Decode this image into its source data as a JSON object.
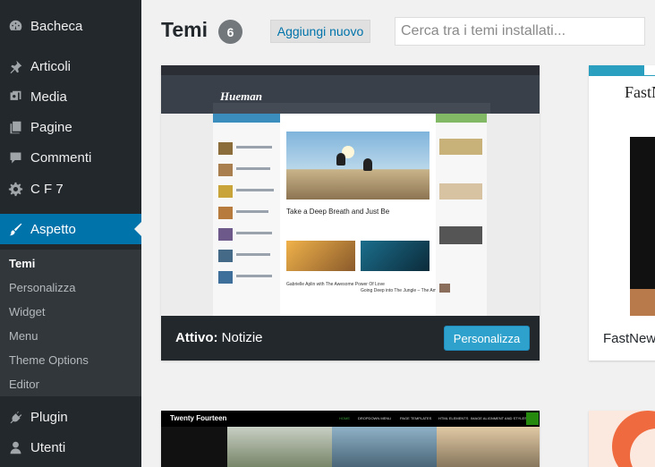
{
  "sidebar": {
    "items": [
      {
        "label": "Bacheca",
        "icon": "dashboard-icon"
      },
      {
        "label": "Articoli",
        "icon": "pin-icon"
      },
      {
        "label": "Media",
        "icon": "media-icon"
      },
      {
        "label": "Pagine",
        "icon": "pages-icon"
      },
      {
        "label": "Commenti",
        "icon": "comments-icon"
      },
      {
        "label": "C F 7",
        "icon": "gear-icon"
      },
      {
        "label": "Aspetto",
        "icon": "brush-icon"
      },
      {
        "label": "Plugin",
        "icon": "plugin-icon"
      },
      {
        "label": "Utenti",
        "icon": "user-icon"
      }
    ],
    "submenu": [
      "Temi",
      "Personalizza",
      "Widget",
      "Menu",
      "Theme Options",
      "Editor"
    ]
  },
  "header": {
    "title": "Temi",
    "count": "6",
    "add_new": "Aggiungi nuovo",
    "search_placeholder": "Cerca tra i temi installati..."
  },
  "active_theme": {
    "active_label": "Attivo:",
    "name": "Notizie",
    "customize_label": "Personalizza",
    "preview": {
      "logo": "Hueman",
      "headline": "Take a Deep Breath and Just Be",
      "post_1": "Gabrielle Aplin with The Awesome Power Of Love",
      "post_2": "Going Deep into The Jungle – The Amazon Forest"
    }
  },
  "other_themes": [
    {
      "name": "FastNew",
      "preview_logo": "FastN"
    },
    {
      "preview_title": "Twenty Fourteen",
      "preview_nav": [
        "HOME",
        "DROPDOWN MENU",
        "PAGE TEMPLATES",
        "HTML ELEMENTS",
        "IMAGE ALIGNMENT AND STYLES"
      ]
    }
  ],
  "colors": {
    "sidebar_bg": "#23282d",
    "active_menu": "#0073aa",
    "accent_button": "#2ea2cc"
  }
}
